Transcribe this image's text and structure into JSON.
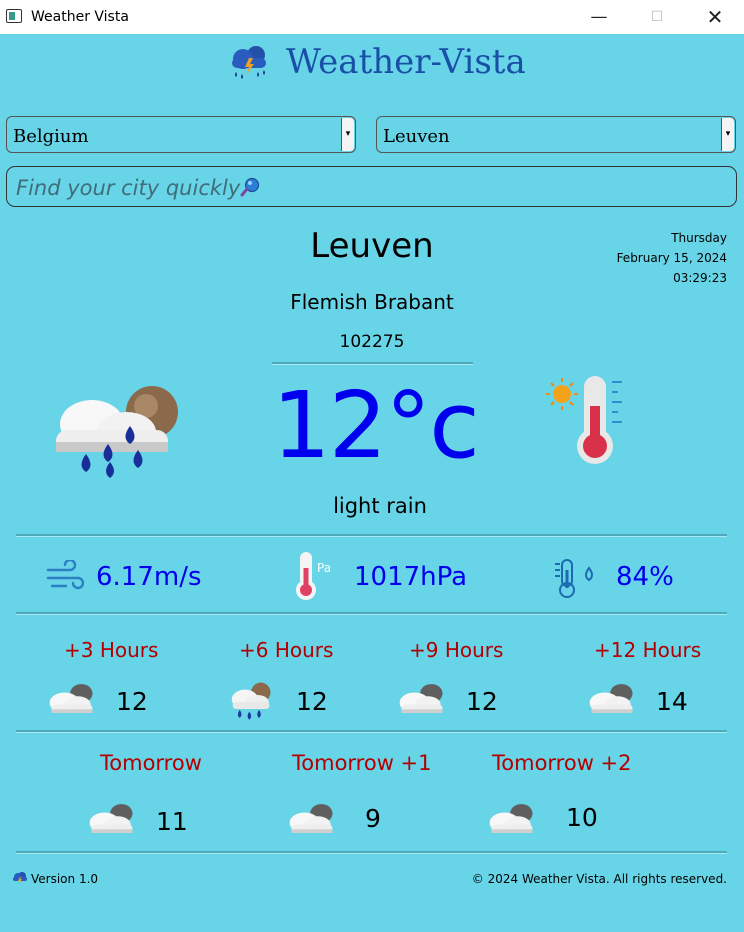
{
  "window": {
    "title": "Weather Vista",
    "min_glyph": "—",
    "max_glyph": "☐",
    "close_glyph": "✕"
  },
  "brand": {
    "title": "Weather-Vista"
  },
  "filters": {
    "country": "Belgium",
    "city": "Leuven",
    "arrow": "▾"
  },
  "search": {
    "placeholder": "Find your city quickly"
  },
  "current": {
    "city": "Leuven",
    "region": "Flemish Brabant",
    "city_id": "102275",
    "temperature": "12°c",
    "description": "light rain",
    "day": "Thursday",
    "date": "February 15, 2024",
    "time": "03:29:23"
  },
  "stats": {
    "wind": "6.17m/s",
    "pressure": "1017hPa",
    "pressure_unit": "Pa",
    "humidity": "84%"
  },
  "hourly": [
    {
      "label": "+3 Hours",
      "temp": "12",
      "icon": "cloudy-icon"
    },
    {
      "label": "+6 Hours",
      "temp": "12",
      "icon": "rain-cloud-icon"
    },
    {
      "label": "+9 Hours",
      "temp": "12",
      "icon": "cloudy-icon"
    },
    {
      "label": "+12 Hours",
      "temp": "14",
      "icon": "cloudy-icon"
    }
  ],
  "daily": [
    {
      "label": "Tomorrow",
      "temp": "11",
      "icon": "cloudy-icon"
    },
    {
      "label": "Tomorrow +1",
      "temp": "9",
      "icon": "cloudy-icon"
    },
    {
      "label": "Tomorrow +2",
      "temp": "10",
      "icon": "cloudy-icon"
    }
  ],
  "footer": {
    "version": "Version 1.0",
    "copyright": "© 2024 Weather Vista. All rights reserved."
  },
  "colors": {
    "background": "#67d4e7",
    "brand": "#1a4fa8",
    "accent_blue": "#0000ee",
    "forecast_label": "#b20000"
  }
}
